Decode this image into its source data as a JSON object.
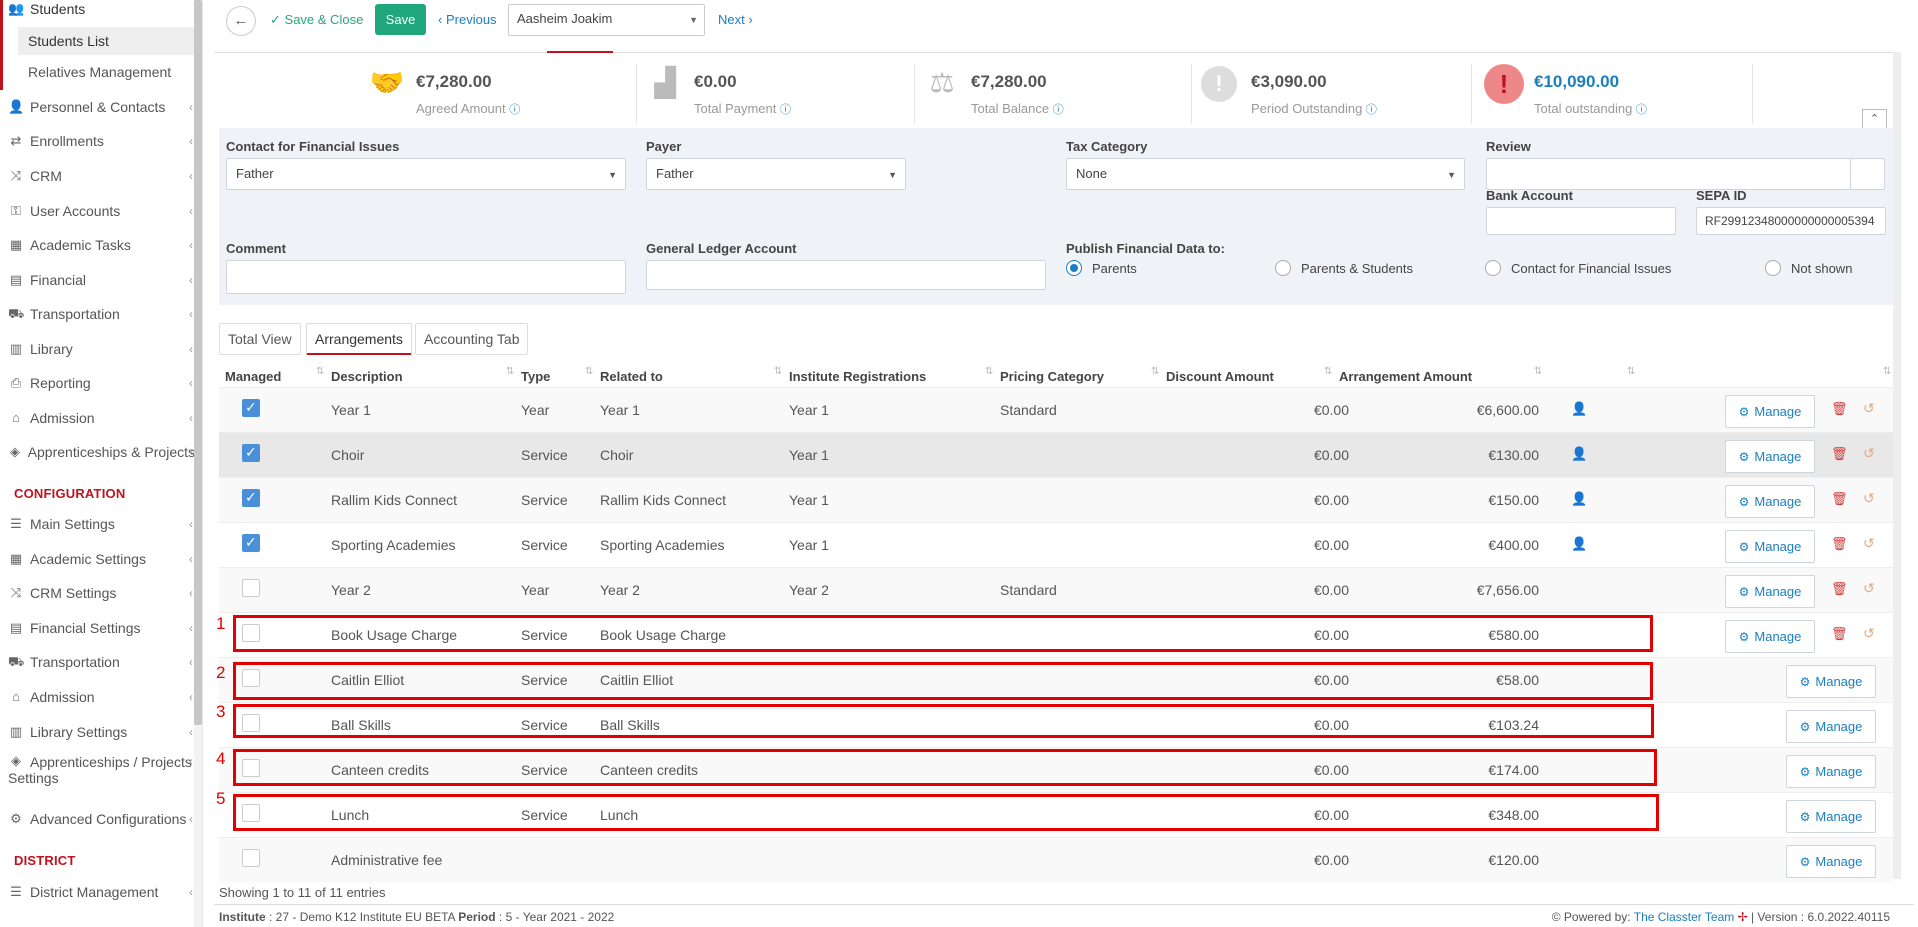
{
  "sidebar": {
    "students": "Students",
    "students_list": "Students List",
    "relatives": "Relatives Management",
    "items": [
      {
        "label": "Personnel & Contacts",
        "icon": "people-icon"
      },
      {
        "label": "Enrollments",
        "icon": "transfer-icon"
      },
      {
        "label": "CRM",
        "icon": "crm-icon"
      },
      {
        "label": "User Accounts",
        "icon": "key-icon"
      },
      {
        "label": "Academic Tasks",
        "icon": "tasks-icon"
      },
      {
        "label": "Financial",
        "icon": "money-icon"
      },
      {
        "label": "Transportation",
        "icon": "bus-icon"
      },
      {
        "label": "Library",
        "icon": "library-icon"
      },
      {
        "label": "Reporting",
        "icon": "printer-icon"
      },
      {
        "label": "Admission",
        "icon": "bank-icon"
      },
      {
        "label": "Apprenticeships & Projects",
        "icon": "cube-icon"
      }
    ],
    "config_section": "CONFIGURATION",
    "config_items": [
      {
        "label": "Main Settings",
        "icon": "sliders-icon"
      },
      {
        "label": "Academic Settings",
        "icon": "school-icon"
      },
      {
        "label": "CRM Settings",
        "icon": "crm-icon"
      },
      {
        "label": "Financial Settings",
        "icon": "money-icon"
      },
      {
        "label": "Transportation",
        "icon": "bus-icon"
      },
      {
        "label": "Admission",
        "icon": "bank-icon"
      },
      {
        "label": "Library Settings",
        "icon": "library-icon"
      },
      {
        "label": "Apprenticeships / Projects",
        "label2": "Settings",
        "icon": "cube-icon"
      },
      {
        "label": "Advanced Configurations",
        "icon": "gears-icon"
      }
    ],
    "district_section": "DISTRICT",
    "district_items": [
      {
        "label": "District Management",
        "icon": "list-icon"
      }
    ]
  },
  "toolbar": {
    "save_close": "Save & Close",
    "save": "Save",
    "previous": "Previous",
    "student": "Aasheim Joakim",
    "next": "Next"
  },
  "summary": [
    {
      "value": "€7,280.00",
      "label": "Agreed Amount",
      "icon": "handshake-icon"
    },
    {
      "value": "€0.00",
      "label": "Total Payment",
      "icon": "chart-icon"
    },
    {
      "value": "€7,280.00",
      "label": "Total Balance",
      "icon": "scale-icon"
    },
    {
      "value": "€3,090.00",
      "label": "Period Outstanding",
      "icon": "exclamation-icon"
    },
    {
      "value": "€10,090.00",
      "label": "Total outstanding",
      "icon": "alert-icon"
    }
  ],
  "financial": {
    "contact_label": "Contact for Financial Issues",
    "contact_value": "Father",
    "payer_label": "Payer",
    "payer_value": "Father",
    "tax_label": "Tax Category",
    "tax_value": "None",
    "review_label": "Review",
    "bank_label": "Bank Account",
    "sepa_label": "SEPA ID",
    "sepa_value": "RF29912348000000000005394",
    "comment_label": "Comment",
    "gl_label": "General Ledger Account",
    "publish_label": "Publish Financial Data to:",
    "publish_options": [
      "Parents",
      "Parents & Students",
      "Contact for Financial Issues",
      "Not shown"
    ]
  },
  "tabs": [
    "Total View",
    "Arrangements",
    "Accounting Tab"
  ],
  "table": {
    "headers": [
      "Managed",
      "Description",
      "Type",
      "Related to",
      "Institute Registrations",
      "Pricing Category",
      "Discount Amount",
      "Arrangement Amount"
    ],
    "manage_label": "Manage",
    "rows": [
      {
        "checked": true,
        "description": "Year 1",
        "type": "Year",
        "related": "Year 1",
        "registration": "Year 1",
        "pricing": "Standard",
        "discount": "€0.00",
        "amount": "€6,600.00"
      },
      {
        "checked": true,
        "description": "Choir",
        "type": "Service",
        "related": "Choir",
        "registration": "Year 1",
        "pricing": "",
        "discount": "€0.00",
        "amount": "€130.00"
      },
      {
        "checked": true,
        "description": "Rallim Kids Connect",
        "type": "Service",
        "related": "Rallim Kids Connect",
        "registration": "Year 1",
        "pricing": "",
        "discount": "€0.00",
        "amount": "€150.00"
      },
      {
        "checked": true,
        "description": "Sporting Academies",
        "type": "Service",
        "related": "Sporting Academies",
        "registration": "Year 1",
        "pricing": "",
        "discount": "€0.00",
        "amount": "€400.00"
      },
      {
        "checked": false,
        "description": "Year 2",
        "type": "Year",
        "related": "Year 2",
        "registration": "Year 2",
        "pricing": "Standard",
        "discount": "€0.00",
        "amount": "€7,656.00"
      },
      {
        "checked": false,
        "description": "Book Usage Charge",
        "type": "Service",
        "related": "Book Usage Charge",
        "registration": "",
        "pricing": "",
        "discount": "€0.00",
        "amount": "€580.00"
      },
      {
        "checked": false,
        "description": "Caitlin Elliot",
        "type": "Service",
        "related": "Caitlin Elliot",
        "registration": "",
        "pricing": "",
        "discount": "€0.00",
        "amount": "€58.00"
      },
      {
        "checked": false,
        "description": "Ball Skills",
        "type": "Service",
        "related": "Ball Skills",
        "registration": "",
        "pricing": "",
        "discount": "€0.00",
        "amount": "€103.24"
      },
      {
        "checked": false,
        "description": "Canteen credits",
        "type": "Service",
        "related": "Canteen credits",
        "registration": "",
        "pricing": "",
        "discount": "€0.00",
        "amount": "€174.00"
      },
      {
        "checked": false,
        "description": "Lunch",
        "type": "Service",
        "related": "Lunch",
        "registration": "",
        "pricing": "",
        "discount": "€0.00",
        "amount": "€348.00"
      },
      {
        "checked": false,
        "description": "Administrative fee",
        "type": "",
        "related": "",
        "registration": "",
        "pricing": "",
        "discount": "€0.00",
        "amount": "€120.00"
      }
    ]
  },
  "annotations": [
    "1",
    "2",
    "3",
    "4",
    "5"
  ],
  "footer": {
    "showing": "Showing 1 to 11 of 11 entries",
    "institute_label": "Institute",
    "institute_value": ": 27 - Demo K12 Institute EU BETA",
    "period_label": "Period",
    "period_value": ": 5 - Year 2021 - 2022",
    "powered_by": "Powered by:",
    "team": "The Classter Team",
    "version": "| Version : 6.0.2022.40115"
  }
}
